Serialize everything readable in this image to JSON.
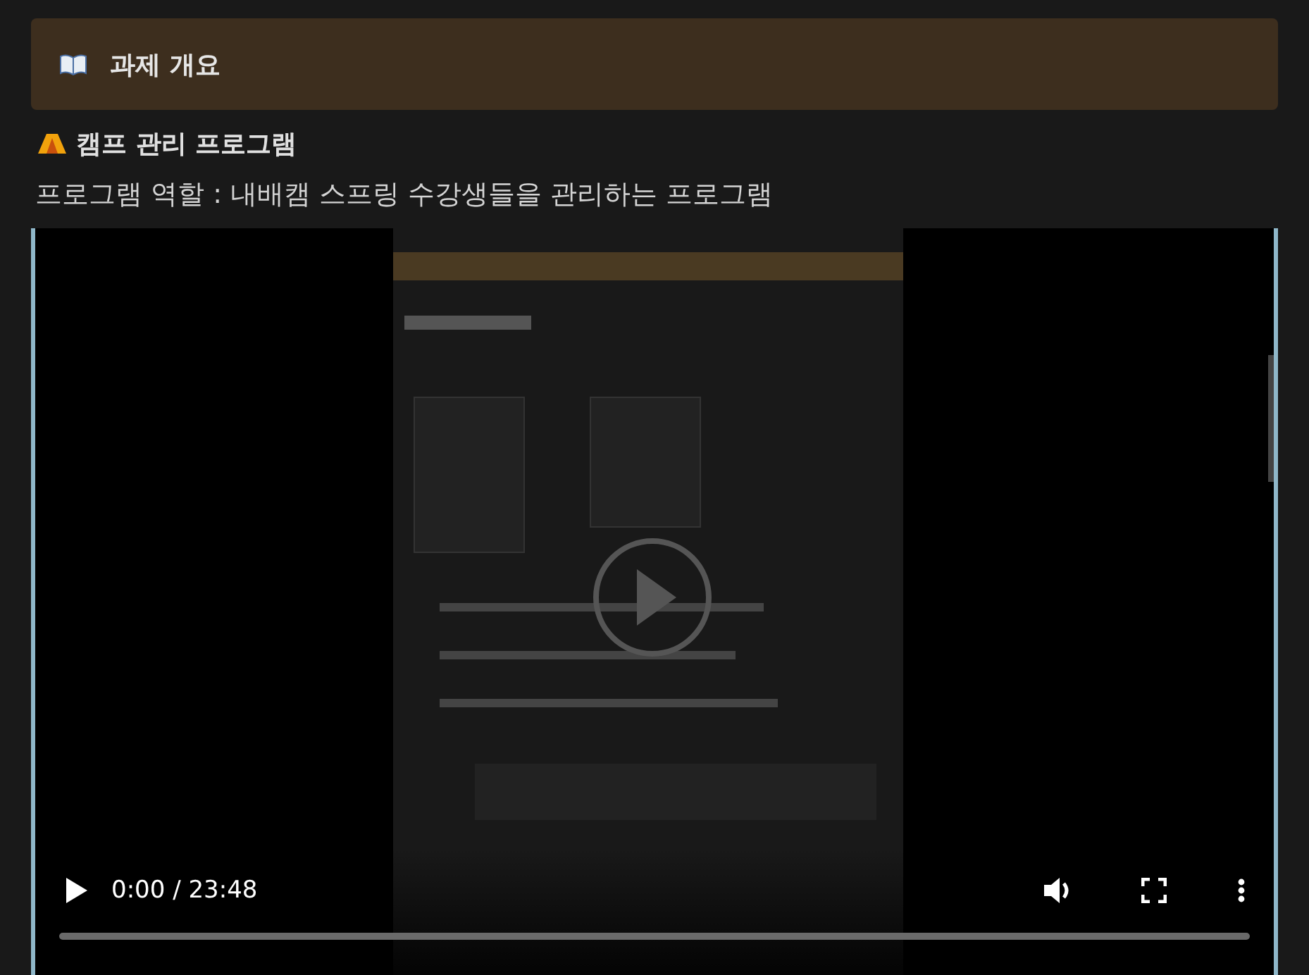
{
  "callout": {
    "title": "과제 개요"
  },
  "heading": "캠프 관리 프로그램",
  "paragraph": "프로그램 역할 : 내배캠 스프링 수강생들을 관리하는 프로그램",
  "video": {
    "kind": "picture",
    "playing": false,
    "time": "0:00 / 23:48",
    "progress": {
      "level": 0
    }
  }
}
